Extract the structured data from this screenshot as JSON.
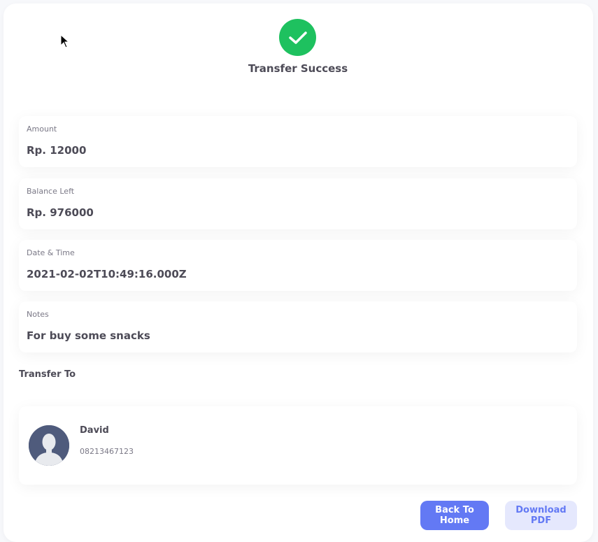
{
  "header": {
    "title": "Transfer Success",
    "status_icon": "check-circle-icon",
    "status_color": "#1ec15f"
  },
  "details": [
    {
      "label": "Amount",
      "value": "Rp. 12000"
    },
    {
      "label": "Balance Left",
      "value": "Rp. 976000"
    },
    {
      "label": "Date & Time",
      "value": "2021-02-02T10:49:16.000Z"
    },
    {
      "label": "Notes",
      "value": "For buy some snacks"
    }
  ],
  "transfer_to": {
    "section_title": "Transfer To",
    "name": "David",
    "phone": "08213467123",
    "avatar_icon": "user-avatar-icon"
  },
  "actions": {
    "back_home_label": "Back To Home",
    "download_pdf_label": "Download PDF",
    "accent_color": "#6379f4"
  }
}
